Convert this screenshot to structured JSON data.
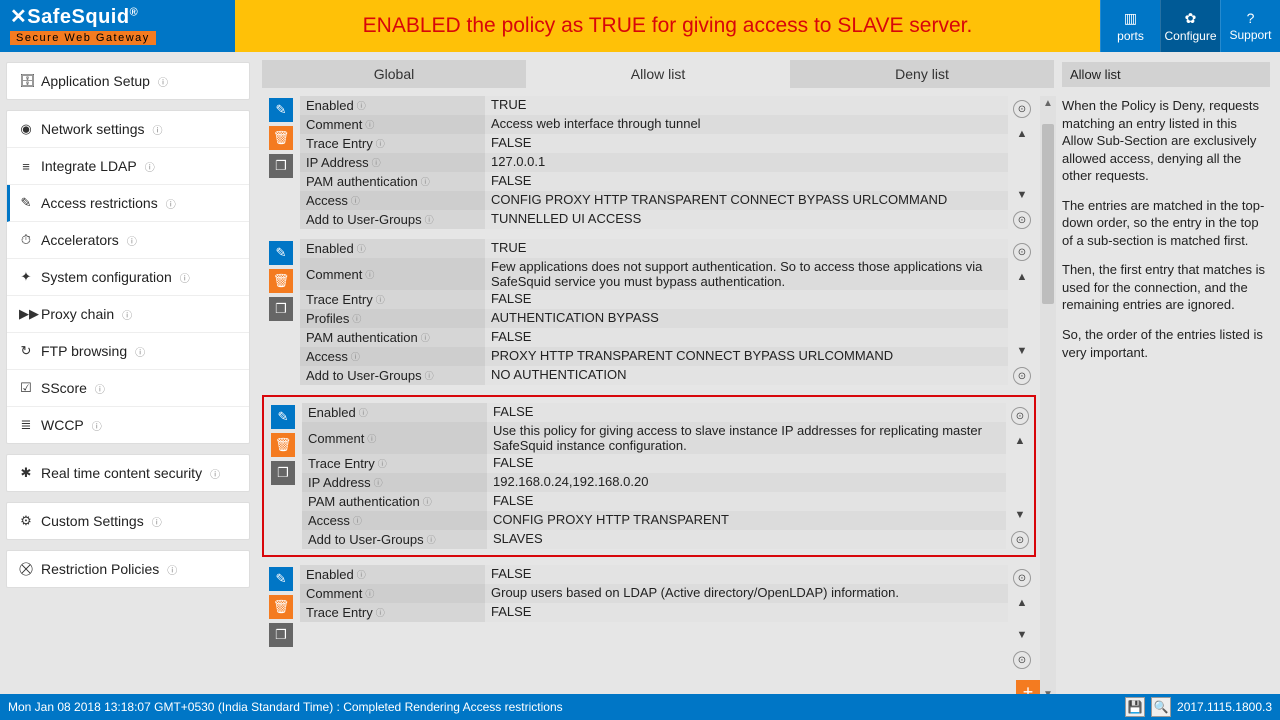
{
  "logo": {
    "title": "SafeSquid",
    "reg": "®",
    "subtitle": "Secure Web Gateway"
  },
  "banner": "ENABLED the policy as TRUE for giving access to SLAVE server.",
  "topnav": [
    {
      "label": "ports",
      "icon": "▥"
    },
    {
      "label": "Configure",
      "icon": "✿",
      "active": true
    },
    {
      "label": "Support",
      "icon": "?"
    }
  ],
  "sidebar": {
    "groups": [
      [
        {
          "icon": "🗄",
          "label": "Application Setup"
        }
      ],
      [
        {
          "icon": "◉",
          "label": "Network settings"
        },
        {
          "icon": "≡",
          "label": "Integrate LDAP"
        },
        {
          "icon": "✎",
          "label": "Access restrictions",
          "active": true
        },
        {
          "icon": "⏱",
          "label": "Accelerators"
        },
        {
          "icon": "✦",
          "label": "System configuration"
        },
        {
          "icon": "▶▶",
          "label": "Proxy chain"
        },
        {
          "icon": "↻",
          "label": "FTP browsing"
        },
        {
          "icon": "☑",
          "label": "SScore"
        },
        {
          "icon": "≣",
          "label": "WCCP"
        }
      ],
      [
        {
          "icon": "✱",
          "label": "Real time content security"
        }
      ],
      [
        {
          "icon": "⚙",
          "label": "Custom Settings"
        }
      ],
      [
        {
          "icon": "⛒",
          "label": "Restriction Policies"
        }
      ]
    ]
  },
  "tabs": [
    {
      "label": "Global"
    },
    {
      "label": "Allow list",
      "active": true
    },
    {
      "label": "Deny list"
    }
  ],
  "policies": [
    {
      "rows": [
        {
          "label": "Enabled",
          "value": "TRUE"
        },
        {
          "label": "Comment",
          "value": "Access web interface through tunnel"
        },
        {
          "label": "Trace Entry",
          "value": "FALSE"
        },
        {
          "label": "IP Address",
          "value": "127.0.0.1"
        },
        {
          "label": "PAM authentication",
          "value": "FALSE"
        },
        {
          "label": "Access",
          "value": "CONFIG   PROXY   HTTP   TRANSPARENT   CONNECT   BYPASS   URLCOMMAND"
        },
        {
          "label": "Add to User-Groups",
          "value": "TUNNELLED UI ACCESS"
        }
      ]
    },
    {
      "rows": [
        {
          "label": "Enabled",
          "value": "TRUE"
        },
        {
          "label": "Comment",
          "value": "Few applications does not support authentication. So to access those applications via SafeSquid service you must bypass authentication."
        },
        {
          "label": "Trace Entry",
          "value": "FALSE"
        },
        {
          "label": "Profiles",
          "value": "AUTHENTICATION BYPASS"
        },
        {
          "label": "PAM authentication",
          "value": "FALSE"
        },
        {
          "label": "Access",
          "value": "PROXY   HTTP   TRANSPARENT   CONNECT   BYPASS   URLCOMMAND"
        },
        {
          "label": "Add to User-Groups",
          "value": "NO AUTHENTICATION"
        }
      ]
    },
    {
      "highlight": true,
      "rows": [
        {
          "label": "Enabled",
          "value": "FALSE"
        },
        {
          "label": "Comment",
          "value": "Use this policy for giving access to slave instance IP addresses for replicating master SafeSquid instance configuration."
        },
        {
          "label": "Trace Entry",
          "value": "FALSE"
        },
        {
          "label": "IP Address",
          "value": "192.168.0.24,192.168.0.20"
        },
        {
          "label": "PAM authentication",
          "value": "FALSE"
        },
        {
          "label": "Access",
          "value": "CONFIG   PROXY   HTTP   TRANSPARENT"
        },
        {
          "label": "Add to User-Groups",
          "value": "SLAVES"
        }
      ]
    },
    {
      "rows": [
        {
          "label": "Enabled",
          "value": "FALSE"
        },
        {
          "label": "Comment",
          "value": "Group users based on LDAP (Active directory/OpenLDAP) information."
        },
        {
          "label": "Trace Entry",
          "value": "FALSE"
        }
      ]
    }
  ],
  "rightpane": {
    "title": "Allow list",
    "paras": [
      "When the Policy is Deny, requests matching an entry listed in this Allow Sub-Section are exclusively allowed access, denying all the other requests.",
      "The entries are matched in the top-down order, so the entry in the top of a sub-section is matched first.",
      "Then, the first entry that matches is used for the connection, and the remaining entries are ignored.",
      "So, the order of the entries listed is very important."
    ]
  },
  "footer": {
    "status": "Mon Jan 08 2018 13:18:07 GMT+0530 (India Standard Time) : Completed Rendering Access restrictions",
    "version": "2017.1115.1800.3"
  }
}
